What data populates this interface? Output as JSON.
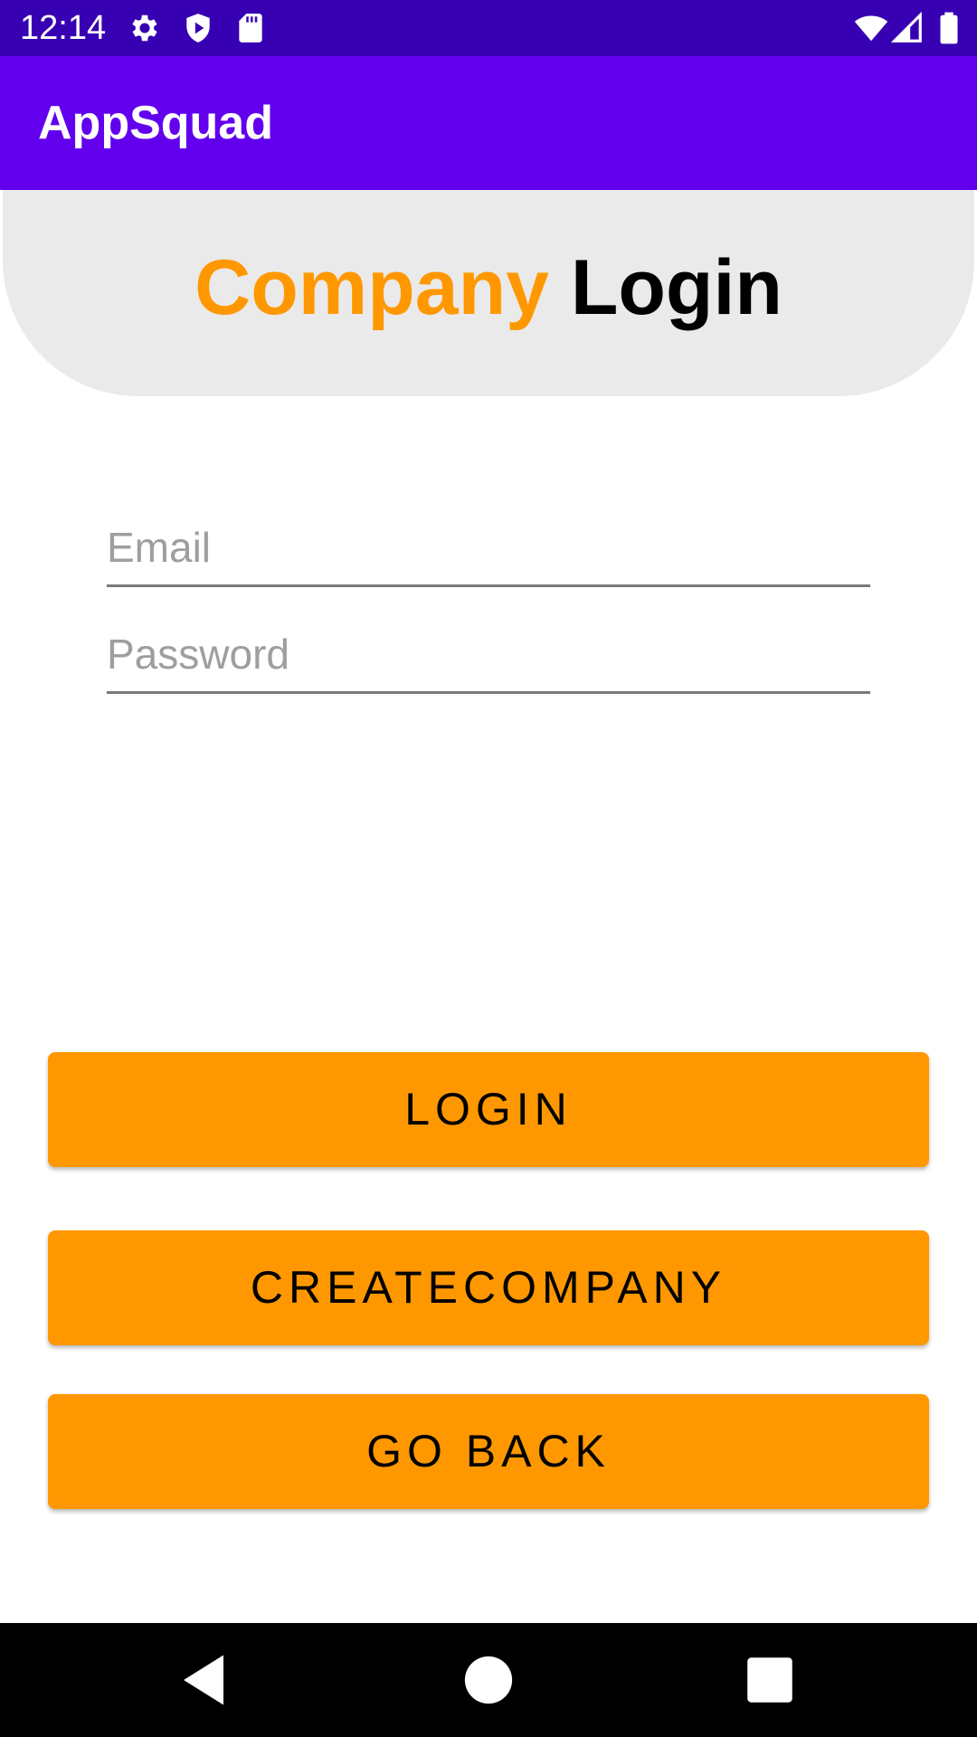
{
  "status_bar": {
    "time": "12:14",
    "left_icons": [
      "gear-icon",
      "shield-icon",
      "sd-card-icon"
    ],
    "right_icons": [
      "wifi-icon",
      "signal-icon",
      "battery-icon"
    ],
    "color": "#3700b3"
  },
  "app_bar": {
    "title": "AppSquad",
    "color": "#6200ee"
  },
  "header": {
    "title_part_1": "Company",
    "title_part_2": "Login",
    "accent_color": "#ff9800"
  },
  "form": {
    "email_placeholder": "Email",
    "email_value": "",
    "password_placeholder": "Password",
    "password_value": ""
  },
  "buttons": {
    "login_label": "LOGIN",
    "create_company_label": "CREATECOMPANY",
    "go_back_label": "GO BACK",
    "color": "#ff9800"
  },
  "nav_bar": {
    "icons": [
      "back-triangle-icon",
      "home-circle-icon",
      "recents-square-icon"
    ]
  }
}
